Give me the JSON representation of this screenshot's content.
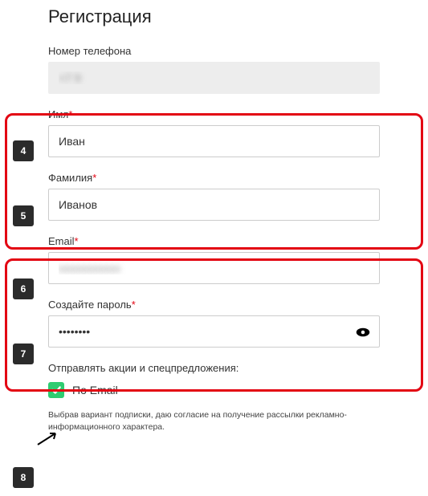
{
  "title": "Регистрация",
  "phone": {
    "label": "Номер телефона",
    "value": "+7 9"
  },
  "firstName": {
    "label": "Имя",
    "value": "Иван"
  },
  "lastName": {
    "label": "Фамилия",
    "value": "Иванов"
  },
  "email": {
    "label": "Email",
    "value": "xxxxxxxxxxx"
  },
  "password": {
    "label": "Создайте пароль",
    "value": "••••••••"
  },
  "subscribe": {
    "heading": "Отправлять акции и спецпредложения:",
    "byEmail": "По Email",
    "checked": true
  },
  "disclaimer": "Выбрав вариант подписки, даю согласие на получение рассылки рекламно-информационного характера.",
  "markers": {
    "m4": "4",
    "m5": "5",
    "m6": "6",
    "m7": "7",
    "m8": "8"
  }
}
